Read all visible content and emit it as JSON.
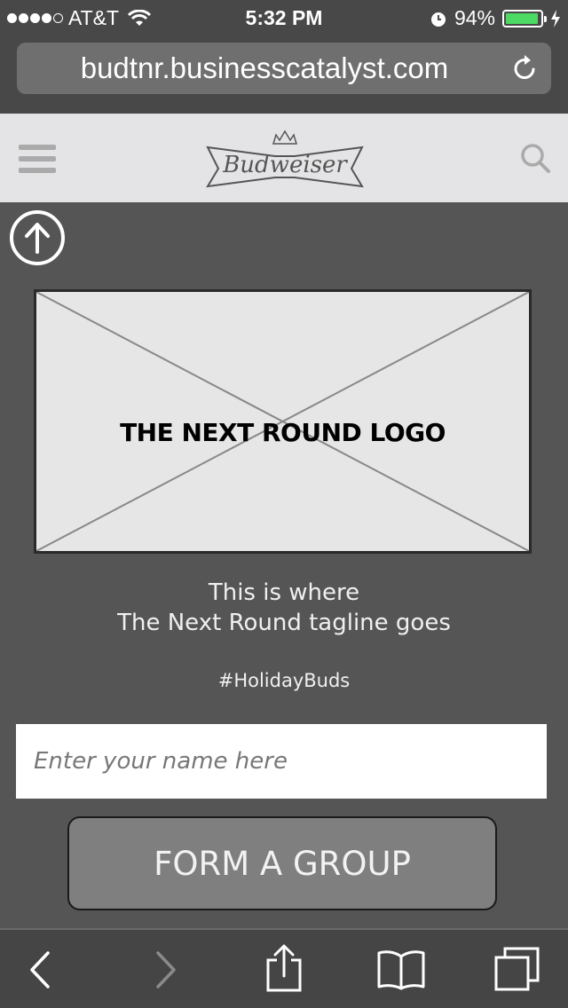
{
  "status_bar": {
    "carrier": "AT&T",
    "time": "5:32 PM",
    "battery_percent": "94%",
    "battery_level": 0.94,
    "battery_color": "#4cd964"
  },
  "browser": {
    "url": "budtnr.businesscatalyst.com",
    "reload_icon": "reload-icon"
  },
  "header": {
    "menu_icon": "hamburger-menu-icon",
    "brand": "Budweiser",
    "search_icon": "search-icon"
  },
  "main": {
    "scroll_top_icon": "arrow-up-circle-icon",
    "logo_placeholder_label": "THE NEXT ROUND LOGO",
    "tagline_line1": "This is where",
    "tagline_line2": "The Next Round tagline goes",
    "hashtag": "#HolidayBuds",
    "name_placeholder": "Enter your name here",
    "name_value": "",
    "form_button_label": "FORM A GROUP"
  },
  "toolbar": {
    "icons": [
      "back-icon",
      "forward-icon",
      "share-icon",
      "bookmarks-icon",
      "tabs-icon"
    ]
  }
}
